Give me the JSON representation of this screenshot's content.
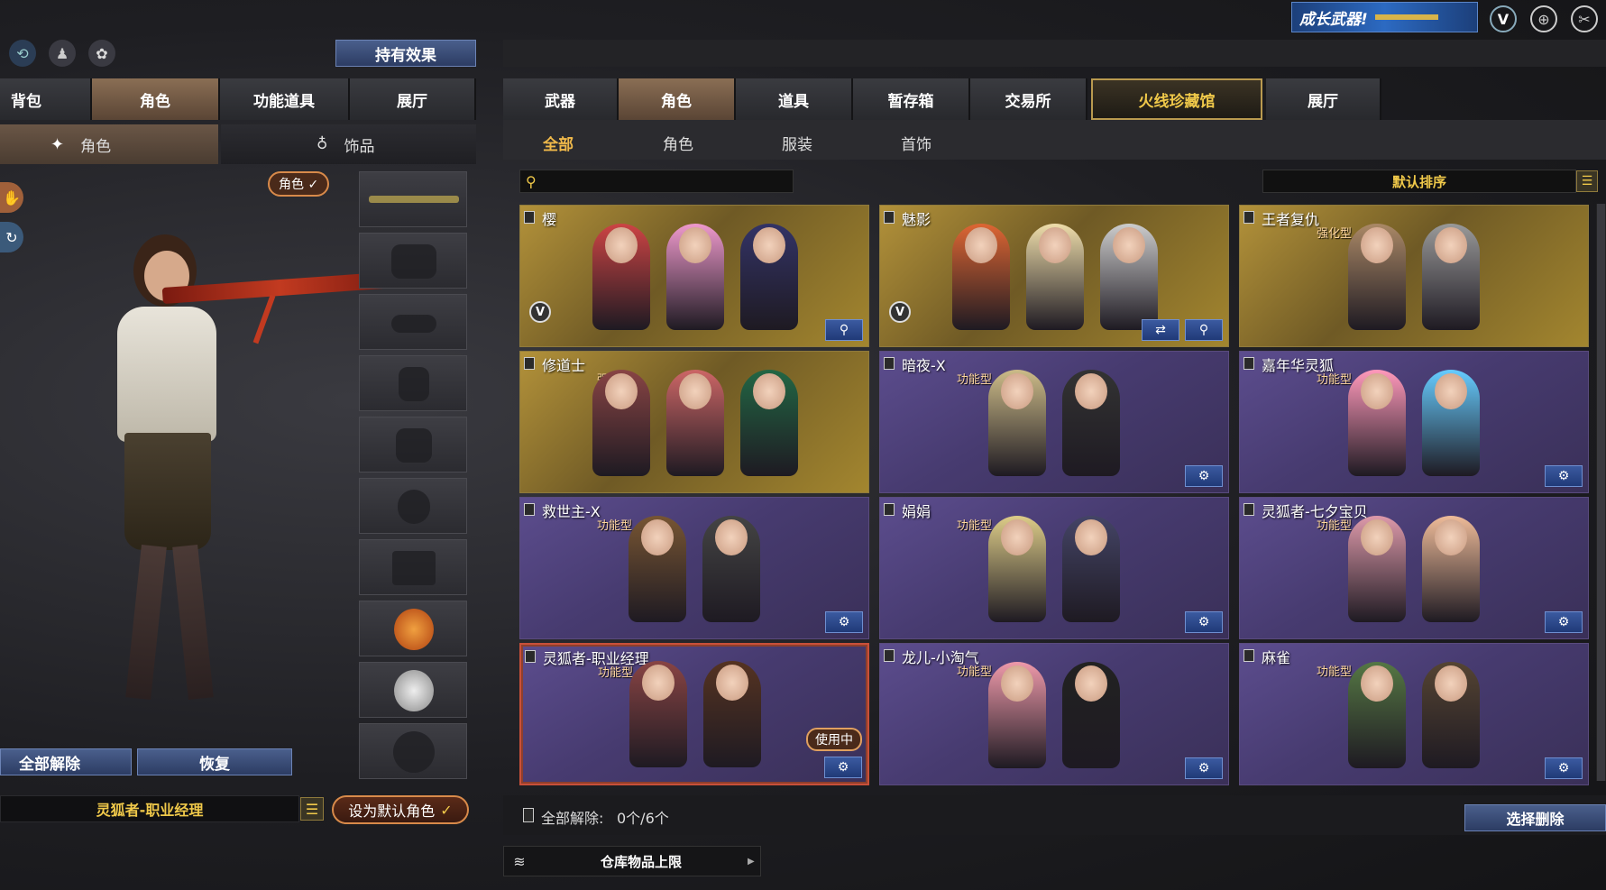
{
  "top_icons": {
    "refresh": "refresh-icon",
    "person": "person-icon",
    "pet": "pet-icon"
  },
  "effect_button": "持有效果",
  "banner": {
    "text": "成长武器!"
  },
  "left_tabs": [
    "背包",
    "角色",
    "功能道具",
    "展厅"
  ],
  "left_subtabs": [
    {
      "label": "角色",
      "icon": "character-icon"
    },
    {
      "label": "饰品",
      "icon": "accessory-icon"
    }
  ],
  "role_badge": "角色",
  "bottom_left": {
    "release_all": "全部解除",
    "restore": "恢复",
    "character_name": "灵狐者-职业经理",
    "set_default": "设为默认角色"
  },
  "main_tabs": [
    "武器",
    "角色",
    "道具",
    "暂存箱",
    "交易所",
    "火线珍藏馆",
    "展厅"
  ],
  "sub_tabs": [
    "全部",
    "角色",
    "服装",
    "首饰"
  ],
  "search": {
    "placeholder": ""
  },
  "sort": {
    "label": "默认排序"
  },
  "cards": [
    {
      "name": "樱",
      "type": "",
      "style": "gold",
      "vip": "V",
      "buttons": [
        "magnify"
      ]
    },
    {
      "name": "魅影",
      "type": "",
      "style": "gold",
      "vip": "V",
      "buttons": [
        "swap",
        "magnify"
      ]
    },
    {
      "name": "王者复仇",
      "type": "强化型",
      "style": "gold",
      "vip": "",
      "buttons": []
    },
    {
      "name": "修道士",
      "type": "强化型",
      "style": "gold",
      "vip": "",
      "buttons": []
    },
    {
      "name": "暗夜-X",
      "type": "功能型",
      "style": "purple",
      "vip": "",
      "buttons": [
        "settings"
      ]
    },
    {
      "name": "嘉年华灵狐",
      "type": "功能型",
      "style": "purple",
      "vip": "",
      "buttons": [
        "settings"
      ]
    },
    {
      "name": "救世主-X",
      "type": "功能型",
      "style": "purple",
      "vip": "",
      "buttons": [
        "settings"
      ]
    },
    {
      "name": "娟娟",
      "type": "功能型",
      "style": "purple",
      "vip": "",
      "buttons": [
        "settings"
      ]
    },
    {
      "name": "灵狐者-七夕宝贝",
      "type": "功能型",
      "style": "purple",
      "vip": "",
      "buttons": [
        "settings"
      ]
    },
    {
      "name": "灵狐者-职业经理",
      "type": "功能型",
      "style": "purple",
      "vip": "",
      "in_use": "使用中",
      "buttons": [
        "settings"
      ]
    },
    {
      "name": "龙儿-小淘气",
      "type": "功能型",
      "style": "purple",
      "vip": "",
      "buttons": [
        "settings"
      ]
    },
    {
      "name": "麻雀",
      "type": "功能型",
      "style": "purple",
      "vip": "",
      "buttons": [
        "settings"
      ]
    }
  ],
  "footer": {
    "release_count_label": "全部解除:",
    "release_count": "0个/6个",
    "select_delete": "选择删除",
    "storage_limit": "仓库物品上限"
  },
  "colors": {
    "accent_gold": "#f0b94a",
    "button_blue": "#2c3c63",
    "card_purple": "#473b70",
    "card_gold": "#8f7a3c"
  }
}
